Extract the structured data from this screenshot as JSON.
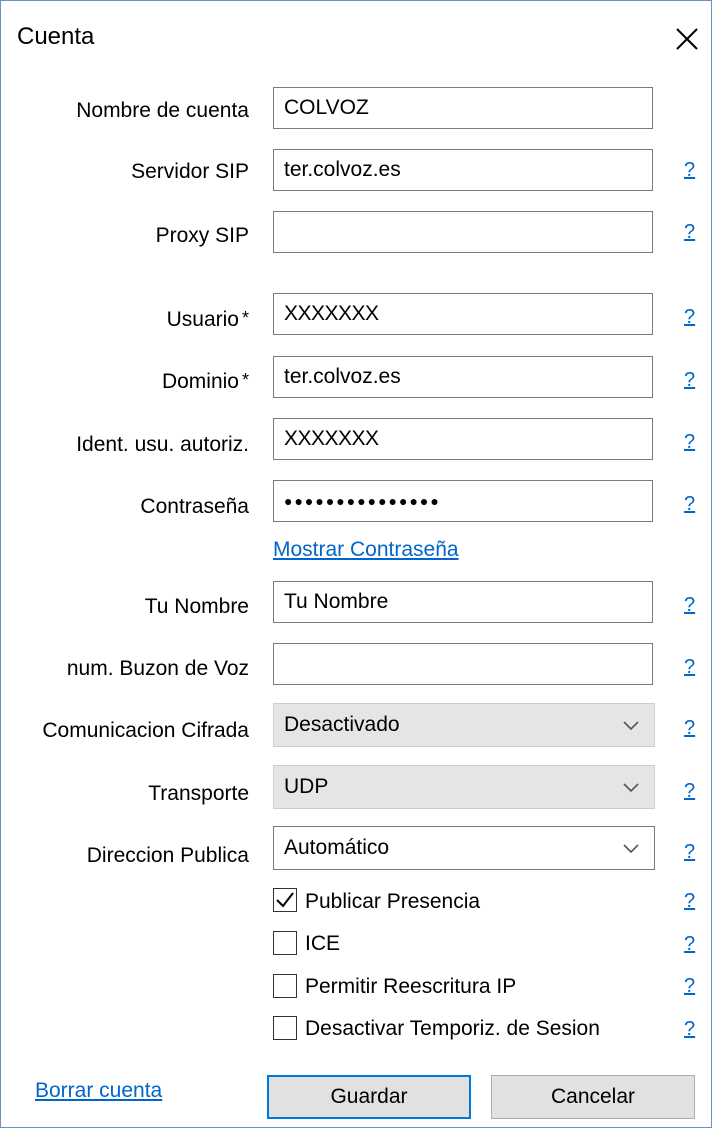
{
  "window": {
    "title": "Cuenta"
  },
  "fields": {
    "account_name": {
      "label": "Nombre de cuenta",
      "value": "COLVOZ"
    },
    "sip_server": {
      "label": "Servidor SIP",
      "value": "ter.colvoz.es"
    },
    "sip_proxy": {
      "label": "Proxy SIP",
      "value": ""
    },
    "user": {
      "label": "Usuario",
      "value": "XXXXXXX"
    },
    "domain": {
      "label": "Dominio",
      "value": "ter.colvoz.es"
    },
    "auth_user": {
      "label": "Ident. usu. autoriz.",
      "value": "XXXXXXX"
    },
    "password": {
      "label": "Contraseña",
      "value": "●●●●●●●●●●●●●●●"
    },
    "your_name": {
      "label": "Tu Nombre",
      "value": "Tu Nombre"
    },
    "voicemail": {
      "label": "num. Buzon de Voz",
      "value": ""
    }
  },
  "required_marker": "*",
  "show_password_link": "Mostrar Contraseña",
  "selects": {
    "encryption": {
      "label": "Comunicacion Cifrada",
      "value": "Desactivado"
    },
    "transport": {
      "label": "Transporte",
      "value": "UDP"
    },
    "public_address": {
      "label": "Direccion Publica",
      "value": "Automático"
    }
  },
  "checkboxes": [
    {
      "label": "Publicar Presencia",
      "checked": true
    },
    {
      "label": "ICE",
      "checked": false
    },
    {
      "label": "Permitir Reescritura IP",
      "checked": false
    },
    {
      "label": "Desactivar Temporiz. de Sesion",
      "checked": false
    }
  ],
  "help_label": "?",
  "footer": {
    "delete_link": "Borrar cuenta",
    "save_label": "Guardar",
    "cancel_label": "Cancelar"
  },
  "colors": {
    "accent": "#0078d7",
    "link": "#0066cc",
    "border": "#6b8fc7"
  }
}
